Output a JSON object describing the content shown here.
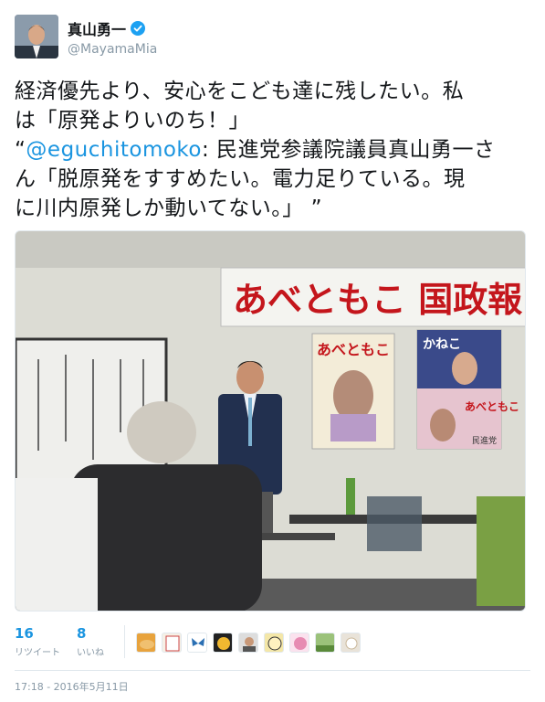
{
  "user": {
    "display_name": "真山勇一",
    "handle": "@MayamaMia",
    "verified": true
  },
  "tweet": {
    "line1": "経済優先より、安心をこども達に残したい。私",
    "line2": "は「原発よりいのち！」",
    "line3_open": "“",
    "mention": "@eguchitomoko",
    "line3_rest": ": 民進党参議院議員真山勇一さ",
    "line4": "ん「脱原発をすすめたい。電力足りている。現",
    "line5": "に川内原発しか動いてない。」 ”"
  },
  "photo": {
    "banner_text": "あべともこ 国政報",
    "poster1_title": "あべともこ",
    "poster2_title": "かねこ",
    "poster2_sub": "あべともこ",
    "party_label": "民進党"
  },
  "stats": {
    "retweets": "16",
    "retweets_label": "リツイート",
    "likes": "8",
    "likes_label": "いいね"
  },
  "timestamp": "17:18 - 2016年5月11日",
  "colors": {
    "accent": "#1b95e0",
    "muted": "#8899a6",
    "banner_red": "#c4161c"
  }
}
